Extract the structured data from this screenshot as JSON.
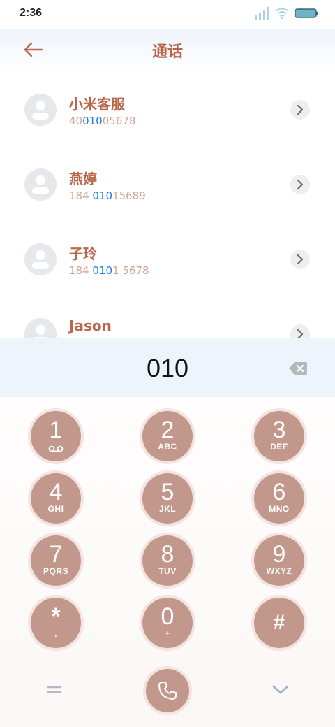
{
  "status_bar": {
    "time": "2:36"
  },
  "header": {
    "title": "通话"
  },
  "contacts": [
    {
      "name": "小米客服",
      "number_pre": "40",
      "number_match": "010",
      "number_post": "05678"
    },
    {
      "name": "燕婷",
      "number_pre": "184 ",
      "number_match": "010",
      "number_post": "15689"
    },
    {
      "name": "子玲",
      "number_pre": "184 ",
      "number_match": "010",
      "number_post": "1 5678"
    },
    {
      "name": "Jason",
      "number_pre": "",
      "number_match": "",
      "number_post": ""
    }
  ],
  "dialer": {
    "input_value": "010"
  },
  "keypad": [
    {
      "digit": "1",
      "letters": ""
    },
    {
      "digit": "2",
      "letters": "ABC"
    },
    {
      "digit": "3",
      "letters": "DEF"
    },
    {
      "digit": "4",
      "letters": "GHI"
    },
    {
      "digit": "5",
      "letters": "JKL"
    },
    {
      "digit": "6",
      "letters": "MNO"
    },
    {
      "digit": "7",
      "letters": "PQRS"
    },
    {
      "digit": "8",
      "letters": "TUV"
    },
    {
      "digit": "9",
      "letters": "WXYZ"
    },
    {
      "digit": "*",
      "letters": ","
    },
    {
      "digit": "0",
      "letters": "+"
    },
    {
      "digit": "#",
      "letters": ""
    }
  ],
  "icons": {
    "back": "arrow-left-icon",
    "backspace": "backspace-icon",
    "call": "phone-icon",
    "menu": "menu-icon",
    "collapse": "chevron-down-icon",
    "voicemail": "voicemail-icon"
  },
  "colors": {
    "accent": "#b9664a",
    "match_highlight": "#1e7be0",
    "key_fill": "#c3988c",
    "display_bg": "#edf4fb"
  }
}
